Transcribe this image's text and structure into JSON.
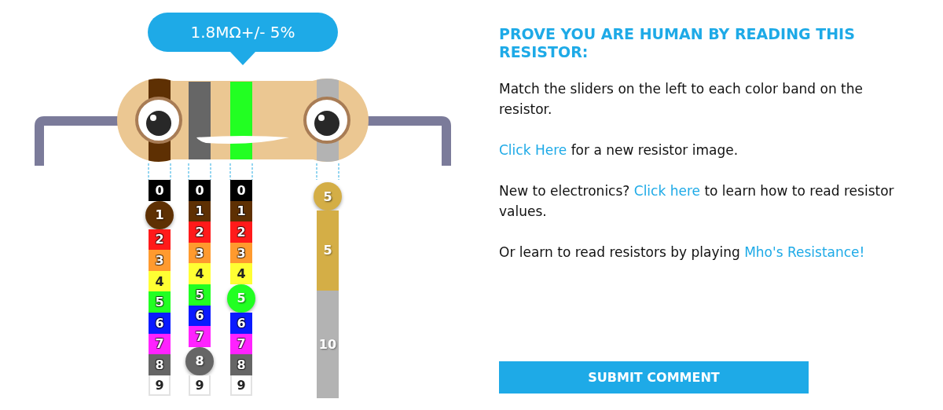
{
  "tooltip": "1.8MΩ+/- 5%",
  "bands": [
    {
      "color": "#5e3003"
    },
    {
      "color": "#666666"
    },
    {
      "color": "#22ff22"
    },
    {
      "color": "#b3b3b3"
    }
  ],
  "digit_sliders": [
    {
      "cells": [
        {
          "label": "0",
          "color": "#000000",
          "selected": false
        },
        {
          "label": "1",
          "color": "#5e3003",
          "selected": true
        },
        {
          "label": "2",
          "color": "#ff1a1a",
          "selected": false
        },
        {
          "label": "3",
          "color": "#ff9a2e",
          "selected": false
        },
        {
          "label": "4",
          "color": "#ffff33",
          "selected": false
        },
        {
          "label": "5",
          "color": "#22ff22",
          "selected": false
        },
        {
          "label": "6",
          "color": "#0a1aff",
          "selected": false
        },
        {
          "label": "7",
          "color": "#ff22ff",
          "selected": false
        },
        {
          "label": "8",
          "color": "#666666",
          "selected": false
        },
        {
          "label": "9",
          "color": "#ffffff",
          "selected": false
        }
      ]
    },
    {
      "cells": [
        {
          "label": "0",
          "color": "#000000",
          "selected": false
        },
        {
          "label": "1",
          "color": "#5e3003",
          "selected": false
        },
        {
          "label": "2",
          "color": "#ff1a1a",
          "selected": false
        },
        {
          "label": "3",
          "color": "#ff9a2e",
          "selected": false
        },
        {
          "label": "4",
          "color": "#ffff33",
          "selected": false
        },
        {
          "label": "5",
          "color": "#22ff22",
          "selected": false
        },
        {
          "label": "6",
          "color": "#0a1aff",
          "selected": false
        },
        {
          "label": "7",
          "color": "#ff22ff",
          "selected": false
        },
        {
          "label": "8",
          "color": "#666666",
          "selected": true
        },
        {
          "label": "9",
          "color": "#ffffff",
          "selected": false
        }
      ]
    },
    {
      "cells": [
        {
          "label": "0",
          "color": "#000000",
          "selected": false
        },
        {
          "label": "1",
          "color": "#5e3003",
          "selected": false
        },
        {
          "label": "2",
          "color": "#ff1a1a",
          "selected": false
        },
        {
          "label": "3",
          "color": "#ff9a2e",
          "selected": false
        },
        {
          "label": "4",
          "color": "#ffff33",
          "selected": false
        },
        {
          "label": "5",
          "color": "#22ff22",
          "selected": true
        },
        {
          "label": "6",
          "color": "#0a1aff",
          "selected": false
        },
        {
          "label": "7",
          "color": "#ff22ff",
          "selected": false
        },
        {
          "label": "8",
          "color": "#666666",
          "selected": false
        },
        {
          "label": "9",
          "color": "#ffffff",
          "selected": false
        }
      ]
    }
  ],
  "tolerance_slider": {
    "knob": "5",
    "segments": [
      {
        "label": "5",
        "color": "#d4ae46",
        "selected": true
      },
      {
        "label": "10",
        "color": "#b3b3b3",
        "selected": false
      }
    ]
  },
  "heading": "PROVE YOU ARE HUMAN BY READING THIS RESISTOR:",
  "paragraphs": [
    [
      {
        "kind": "text",
        "text": "Match the sliders on the left to each color band on the resistor."
      }
    ],
    [
      {
        "kind": "link",
        "text": "Click Here"
      },
      {
        "kind": "text",
        "text": " for a new resistor image."
      }
    ],
    [
      {
        "kind": "text",
        "text": "New to electronics? "
      },
      {
        "kind": "link",
        "text": "Click here"
      },
      {
        "kind": "text",
        "text": " to learn how to read resistor values."
      }
    ],
    [
      {
        "kind": "text",
        "text": "Or learn to read resistors by playing "
      },
      {
        "kind": "link",
        "text": "Mho's Resistance!"
      }
    ]
  ],
  "submit_button": "SUBMIT COMMENT"
}
